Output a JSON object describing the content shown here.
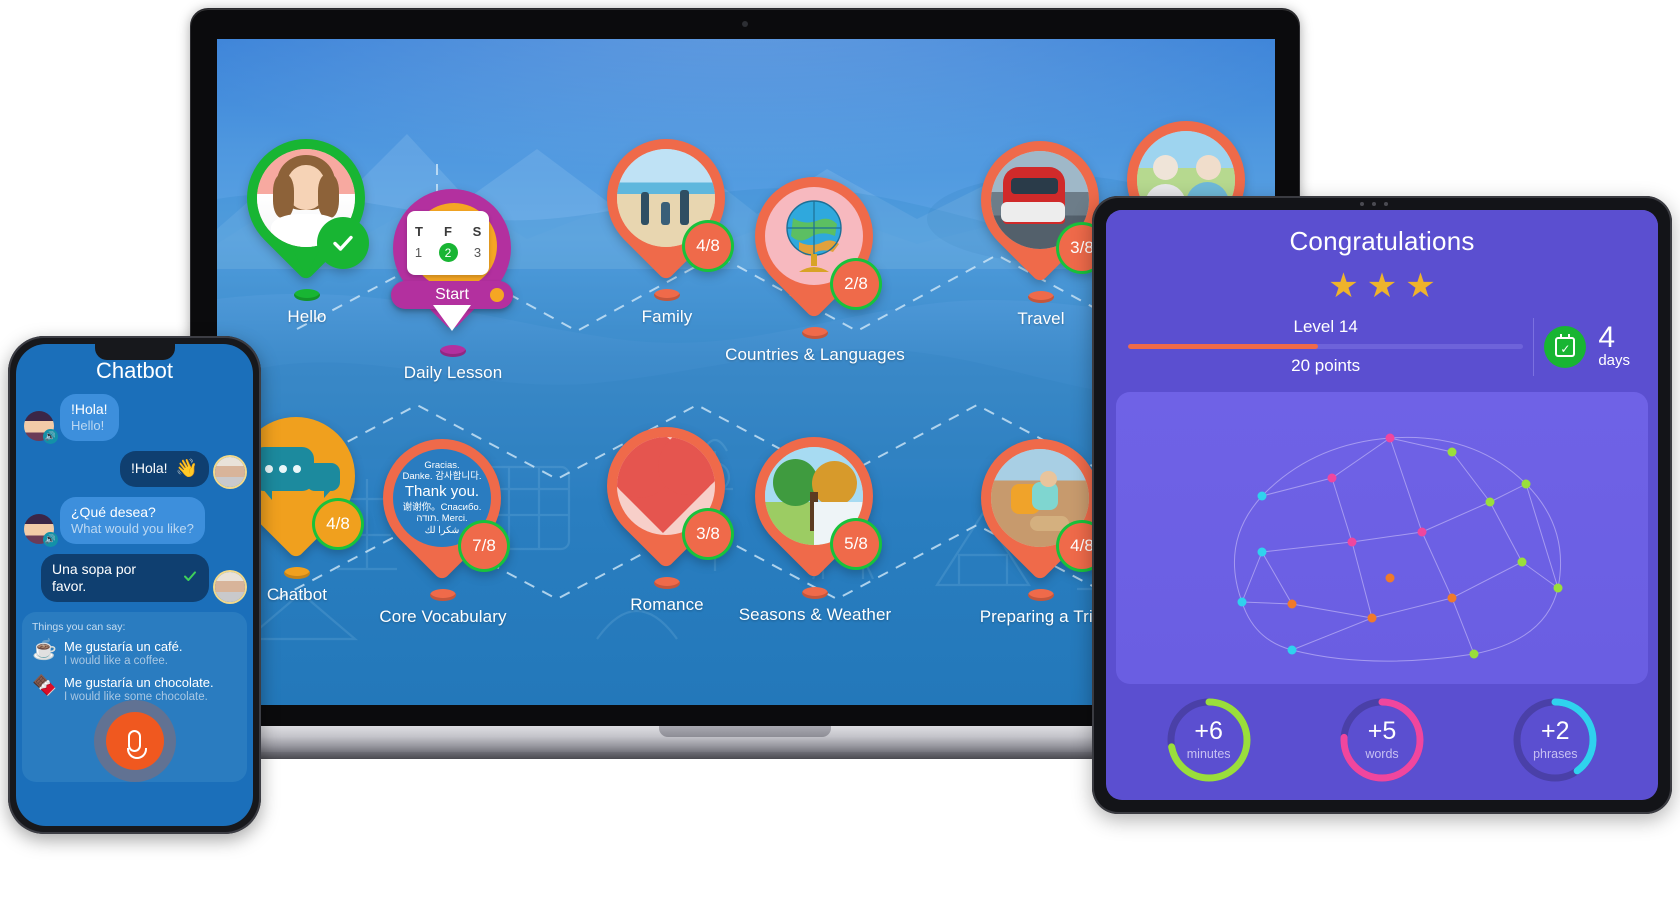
{
  "laptop": {
    "map": {
      "pins": [
        {
          "id": "hello",
          "label": "Hello",
          "badge": "",
          "completed": true,
          "icon": "portrait-woman-icon"
        },
        {
          "id": "daily",
          "label": "Daily Lesson",
          "badge": "",
          "completed": false,
          "icon": "calendar-icon",
          "calendar": {
            "days": [
              "T",
              "F",
              "S"
            ],
            "dates": [
              "1",
              "2",
              "3"
            ],
            "active_date": "2"
          },
          "start_label": "Start"
        },
        {
          "id": "family",
          "label": "Family",
          "badge": "4/8",
          "completed": false,
          "icon": "beach-family-photo-icon"
        },
        {
          "id": "countries",
          "label": "Countries & Languages",
          "badge": "2/8",
          "completed": false,
          "icon": "globe-icon"
        },
        {
          "id": "travel",
          "label": "Travel",
          "badge": "3/8",
          "completed": false,
          "icon": "train-photo-icon"
        },
        {
          "id": "seniors",
          "label": "",
          "badge": "",
          "completed": false,
          "icon": "senior-couple-photo-icon"
        },
        {
          "id": "chatbot",
          "label": "Chatbot",
          "badge": "4/8",
          "completed": false,
          "icon": "speech-bubbles-icon"
        },
        {
          "id": "vocab",
          "label": "Core Vocabulary",
          "badge": "7/8",
          "completed": false,
          "icon": "thank-you-text-icon",
          "lines": [
            "Gracias.",
            "Danke. 감사합니다.",
            "Thank you.",
            "谢谢你。Спасибо.",
            "תודה. Merci.",
            "شكرا لك"
          ]
        },
        {
          "id": "romance",
          "label": "Romance",
          "badge": "3/8",
          "completed": false,
          "icon": "heart-flowers-icon"
        },
        {
          "id": "seasons",
          "label": "Seasons & Weather",
          "badge": "5/8",
          "completed": false,
          "icon": "four-seasons-tree-icon"
        },
        {
          "id": "trip",
          "label": "Preparing a Trip",
          "badge": "4/8",
          "completed": false,
          "icon": "hiker-photo-icon"
        }
      ]
    }
  },
  "phone": {
    "title": "Chatbot",
    "messages": [
      {
        "from": "bot",
        "es": "!Hola!",
        "en": "Hello!",
        "emoji": "",
        "check": false
      },
      {
        "from": "user",
        "es": "!Hola!",
        "en": "",
        "emoji": "👋",
        "check": false
      },
      {
        "from": "bot",
        "es": "¿Qué desea?",
        "en": "What would you like?",
        "emoji": "",
        "check": false
      },
      {
        "from": "user",
        "es": "Una sopa por favor.",
        "en": "",
        "emoji": "",
        "check": true
      }
    ],
    "suggestions": {
      "title": "Things you can say:",
      "items": [
        {
          "emoji": "☕",
          "es": "Me gustaría un café.",
          "en": "I would like a coffee."
        },
        {
          "emoji": "🍫",
          "es": "Me gustaría un chocolate.",
          "en": "I would like some chocolate."
        }
      ]
    },
    "mic_label": "microphone-button"
  },
  "tablet": {
    "title": "Congratulations",
    "stars": 3,
    "level_label": "Level 14",
    "points_label": "20 points",
    "progress_percent": 48,
    "streak": {
      "value": "4",
      "unit": "days"
    },
    "stats": [
      {
        "value": "+6",
        "unit": "minutes",
        "color": "#9ade3b",
        "percent": 72
      },
      {
        "value": "+5",
        "unit": "words",
        "color": "#f0469e",
        "percent": 76
      },
      {
        "value": "+2",
        "unit": "phrases",
        "color": "#2fd2ee",
        "percent": 40
      }
    ]
  },
  "colors": {
    "pin_orange": "#ef6a4a",
    "pin_green": "#18b533",
    "pin_purple": "#b3309f",
    "pin_yellow": "#f0a01e",
    "map_blue": "#2a7cc0",
    "tablet_purple": "#5b4fd0",
    "phone_blue": "#1b6fba"
  }
}
